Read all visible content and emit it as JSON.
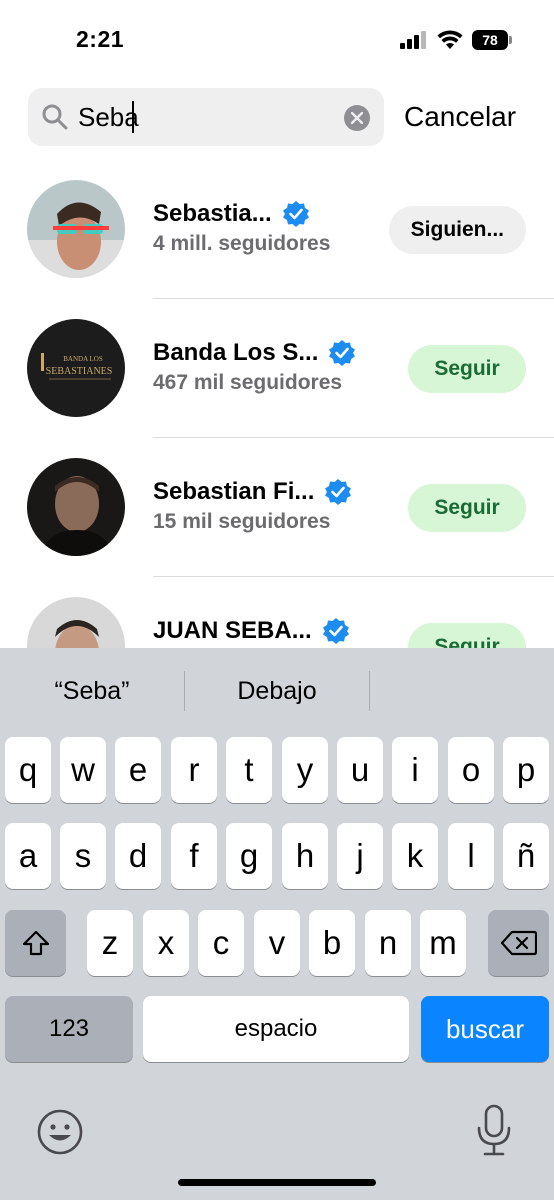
{
  "status_bar": {
    "time": "2:21",
    "battery": "78"
  },
  "search": {
    "value": "Seba",
    "cancel_label": "Cancelar"
  },
  "results": [
    {
      "name": "Sebastia...",
      "followers": "4 mill. seguidores",
      "action": "Siguien...",
      "following": true,
      "avatar_color": "#a9b6b8"
    },
    {
      "name": "Banda Los S...",
      "followers": "467 mil seguidores",
      "action": "Seguir",
      "following": false,
      "avatar_color": "#1c1c1c",
      "avatar_text_top": "BANDA LOS",
      "avatar_text_main": "SEBASTIANES"
    },
    {
      "name": "Sebastian Fi...",
      "followers": "15 mil seguidores",
      "action": "Seguir",
      "following": false,
      "avatar_color": "#2a2622"
    },
    {
      "name": "JUAN SEBA...",
      "followers": "",
      "action": "Seguir",
      "following": false,
      "avatar_color": "#cfcfcf"
    }
  ],
  "keyboard": {
    "suggestions": [
      "“Seba”",
      "Debajo",
      ""
    ],
    "row1": [
      "q",
      "w",
      "e",
      "r",
      "t",
      "y",
      "u",
      "i",
      "o",
      "p"
    ],
    "row2": [
      "a",
      "s",
      "d",
      "f",
      "g",
      "h",
      "j",
      "k",
      "l",
      "ñ"
    ],
    "row3": [
      "z",
      "x",
      "c",
      "v",
      "b",
      "n",
      "m"
    ],
    "numbers_label": "123",
    "space_label": "espacio",
    "search_label": "buscar"
  },
  "colors": {
    "accent_blue": "#0a84ff",
    "follow_green_bg": "#d6f6d6",
    "follow_green_text": "#1b6b35",
    "verified_blue": "#1d8cf0"
  }
}
